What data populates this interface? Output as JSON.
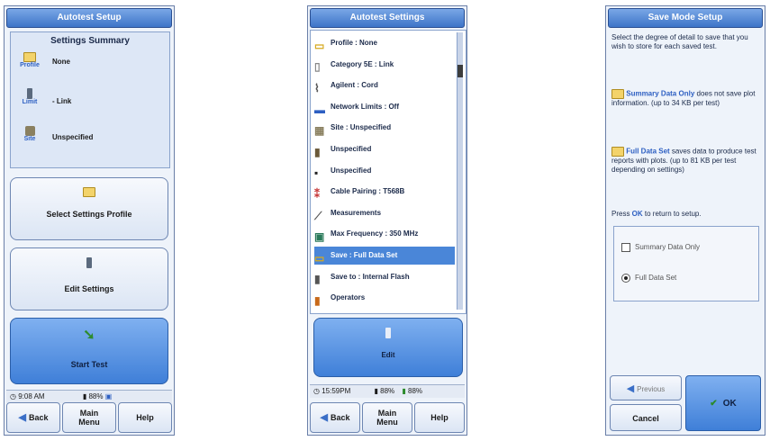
{
  "panel1": {
    "title": "Autotest Setup",
    "summary_heading": "Settings Summary",
    "profile_label": "Profile",
    "profile_value": "None",
    "limit_label": "Limit",
    "limit_value": "- Link",
    "site_label": "Site",
    "site_value": "Unspecified",
    "select_profile_button": "Select Settings Profile",
    "edit_settings_button": "Edit Settings",
    "start_test_button": "Start Test",
    "status_time": "9:08 AM",
    "status_battery": "88%",
    "back_button": "Back",
    "main_menu_button": "Main Menu",
    "help_button": "Help"
  },
  "panel2": {
    "title": "Autotest Settings",
    "items": [
      {
        "label": "Profile : None",
        "icon": "folder-icon"
      },
      {
        "label": "Category 5E : Link",
        "icon": "document-icon"
      },
      {
        "label": "Agilent : Cord",
        "icon": "cable-icon"
      },
      {
        "label": "Network Limits : Off",
        "icon": "network-icon"
      },
      {
        "label": "Site : Unspecified",
        "icon": "building-icon"
      },
      {
        "label": "Unspecified",
        "icon": "person-icon"
      },
      {
        "label": "Unspecified",
        "icon": "device-icon"
      },
      {
        "label": "Cable Pairing : T568B",
        "icon": "pairing-icon"
      },
      {
        "label": "Measurements",
        "icon": "measure-icon"
      },
      {
        "label": "Max Frequency : 350 MHz",
        "icon": "frequency-icon"
      },
      {
        "label": "Save : Full Data Set",
        "icon": "save-folder-icon"
      },
      {
        "label": "Save to : Internal Flash",
        "icon": "flash-icon"
      },
      {
        "label": "Operators",
        "icon": "operators-icon"
      }
    ],
    "selected_index": 10,
    "edit_button": "Edit",
    "status_time": "15:59PM",
    "status_battery": "88%",
    "status_battery2": "88%",
    "back_button": "Back",
    "main_menu_button": "Main Menu",
    "help_button": "Help"
  },
  "panel3": {
    "title": "Save Mode Setup",
    "intro": "Select the degree of detail to save that you wish to store for each saved test.",
    "summary_name": "Summary Data Only",
    "summary_desc": " does not save plot information. (up to 34 KB per test)",
    "full_name": "Full Data Set",
    "full_desc": " saves data to produce test reports with plots. (up to 81 KB per test depending on settings)",
    "press_ok_prefix": "Press ",
    "press_ok_ok": "OK",
    "press_ok_suffix": " to return to setup.",
    "option_summary": "Summary Data Only",
    "option_full": "Full Data Set",
    "selected_option": "Full Data Set",
    "previous_button": "Previous",
    "cancel_button": "Cancel",
    "ok_button": "OK"
  }
}
